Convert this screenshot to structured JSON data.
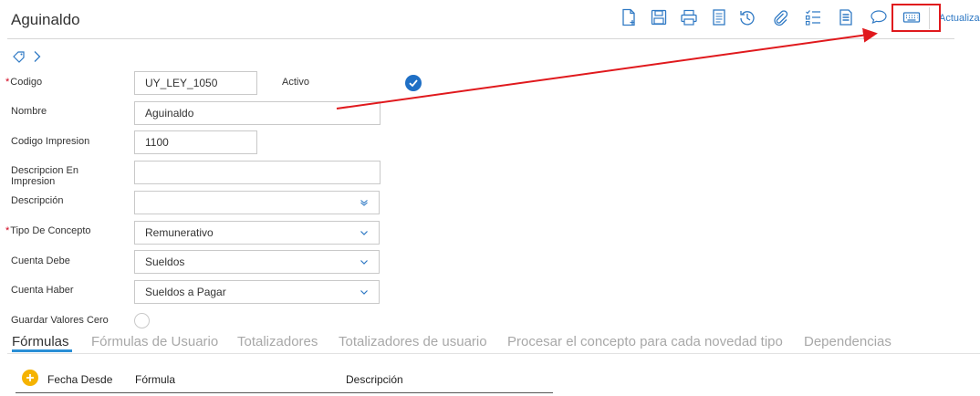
{
  "page": {
    "title": "Aguinaldo"
  },
  "toolbar": {
    "buttons": [
      {
        "icon": "new-document-icon"
      },
      {
        "icon": "save-icon"
      },
      {
        "icon": "print-icon"
      },
      {
        "icon": "document-list-icon"
      },
      {
        "icon": "history-icon"
      },
      {
        "icon": "attachment-icon"
      },
      {
        "icon": "checklist-icon"
      },
      {
        "icon": "report-icon"
      },
      {
        "icon": "comment-icon"
      },
      {
        "icon": "keyboard-icon"
      }
    ],
    "update_link": "Actualizar"
  },
  "form": {
    "codigo": {
      "label": "Codigo",
      "required_mark": "*",
      "value": "UY_LEY_1050"
    },
    "activo": {
      "label": "Activo",
      "checked": true
    },
    "nombre": {
      "label": "Nombre",
      "value": "Aguinaldo"
    },
    "codigo_impresion": {
      "label": "Codigo Impresion",
      "value": "1100"
    },
    "descripcion_en_impresion": {
      "label": "Descripcion En Impresion",
      "value": ""
    },
    "descripcion": {
      "label": "Descripción",
      "value": ""
    },
    "tipo_de_concepto": {
      "label": "Tipo De Concepto",
      "required_mark": "*",
      "value": "Remunerativo"
    },
    "cuenta_debe": {
      "label": "Cuenta Debe",
      "value": "Sueldos"
    },
    "cuenta_haber": {
      "label": "Cuenta Haber",
      "value": "Sueldos a Pagar"
    },
    "guardar_valores_cero": {
      "label": "Guardar Valores Cero",
      "checked": false
    }
  },
  "tabs": [
    {
      "label": "Fórmulas",
      "active": true
    },
    {
      "label": "Fórmulas de Usuario",
      "active": false
    },
    {
      "label": "Totalizadores",
      "active": false
    },
    {
      "label": "Totalizadores de usuario",
      "active": false
    },
    {
      "label": "Procesar el concepto para cada novedad tipo",
      "active": false
    },
    {
      "label": "Dependencias",
      "active": false
    }
  ],
  "grid": {
    "columns": [
      "Fecha Desde",
      "Fórmula",
      "Descripción"
    ]
  },
  "colors": {
    "accent": "#2a8fd6",
    "icon_blue": "#2f79c4",
    "required": "#d0021b",
    "annotation_red": "#e0191d",
    "add_button": "#f5b301"
  }
}
